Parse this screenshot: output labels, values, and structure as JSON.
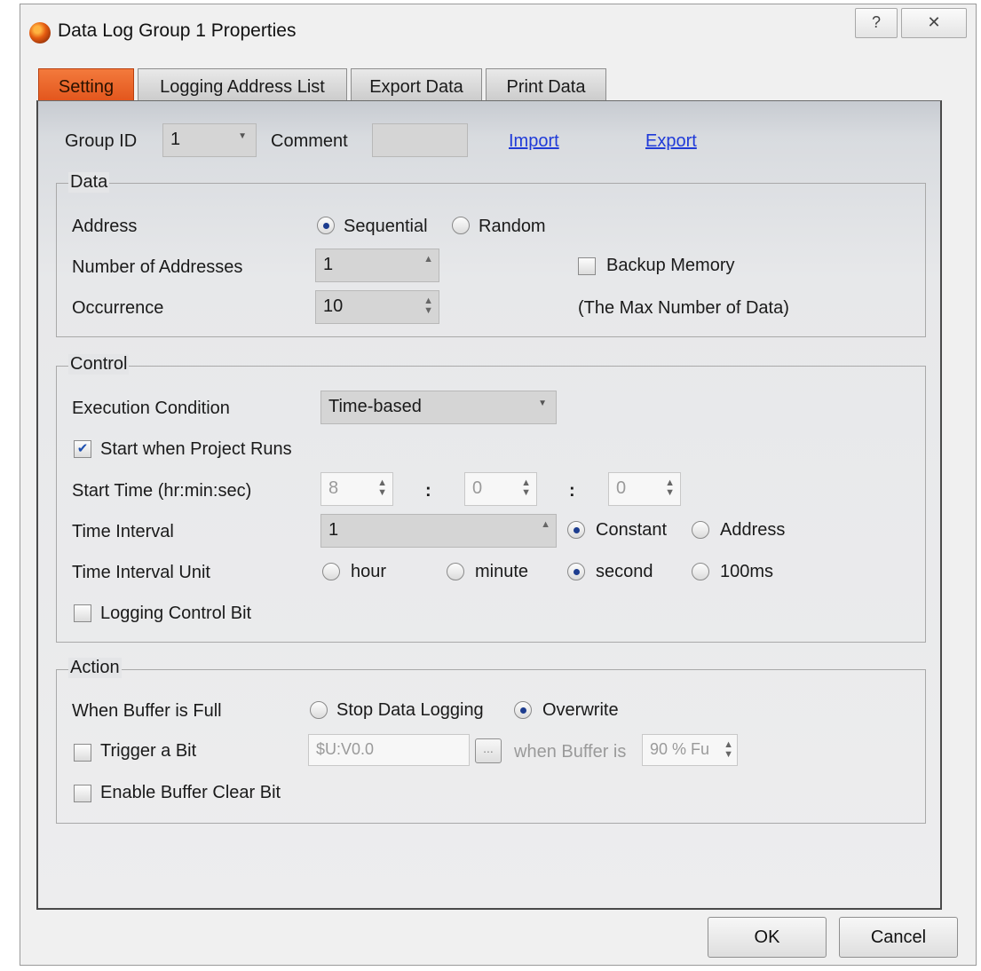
{
  "window": {
    "title": "Data Log Group 1 Properties",
    "help_glyph": "?",
    "close_glyph": "✕"
  },
  "tabs": [
    {
      "label": "Setting"
    },
    {
      "label": "Logging Address List"
    },
    {
      "label": "Export Data"
    },
    {
      "label": "Print Data"
    }
  ],
  "top": {
    "group_id_label": "Group ID",
    "group_id_value": "1",
    "comment_label": "Comment",
    "comment_value": "",
    "import_link": "Import",
    "export_link": "Export"
  },
  "data_group": {
    "title": "Data",
    "address_label": "Address",
    "address_options": [
      "Sequential",
      "Random"
    ],
    "address_selected": "Sequential",
    "num_addresses_label": "Number of Addresses",
    "num_addresses_value": "1",
    "backup_memory_label": "Backup Memory",
    "backup_memory_checked": false,
    "occurrence_label": "Occurrence",
    "occurrence_value": "10",
    "max_note": "(The Max Number of Data)"
  },
  "control_group": {
    "title": "Control",
    "exec_condition_label": "Execution Condition",
    "exec_condition_value": "Time-based",
    "start_when_runs_label": "Start when Project Runs",
    "start_when_runs_checked": true,
    "start_time_label": "Start Time (hr:min:sec)",
    "start_hr": "8",
    "start_min": "0",
    "start_sec": "0",
    "time_sep": ":",
    "time_interval_label": "Time Interval",
    "time_interval_value": "1",
    "interval_mode_options": [
      "Constant",
      "Address"
    ],
    "interval_mode_selected": "Constant",
    "unit_label": "Time Interval Unit",
    "unit_options": [
      "hour",
      "minute",
      "second",
      "100ms"
    ],
    "unit_selected": "second",
    "logging_control_label": "Logging Control Bit",
    "logging_control_checked": false
  },
  "action_group": {
    "title": "Action",
    "buffer_full_label": "When Buffer is Full",
    "buffer_full_options": [
      "Stop Data Logging",
      "Overwrite"
    ],
    "buffer_full_selected": "Overwrite",
    "trigger_bit_label": "Trigger a Bit",
    "trigger_bit_checked": false,
    "trigger_address": "$U:V0.0",
    "browse_label": "...",
    "when_buffer_label": "when Buffer is",
    "buffer_percent": "90 % Fu",
    "buffer_clear_label": "Enable Buffer Clear Bit",
    "buffer_clear_checked": false
  },
  "footer": {
    "ok_label": "OK",
    "cancel_label": "Cancel"
  },
  "colors": {
    "active_tab": "#e1521a",
    "link": "#1f3ad8",
    "radio_dot": "#1d3d8f"
  }
}
